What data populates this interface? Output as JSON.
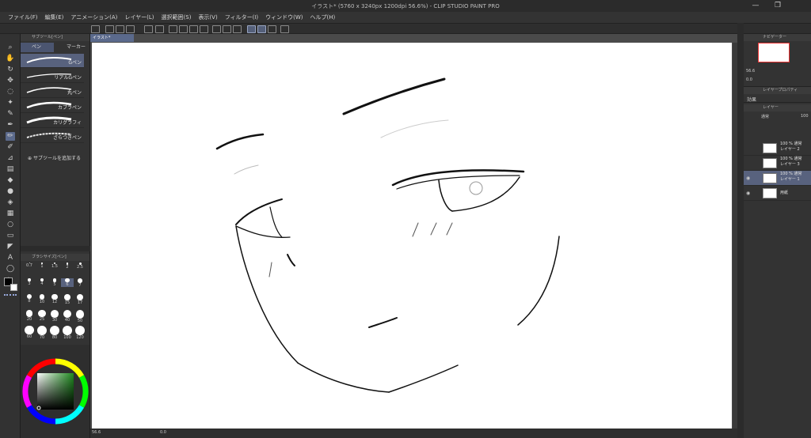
{
  "window": {
    "title": "イラスト* (5760 x 3240px 1200dpi 56.6%) - CLIP STUDIO PAINT PRO",
    "min": "—",
    "restore": "❐"
  },
  "menu": [
    "ファイル(F)",
    "編集(E)",
    "アニメーション(A)",
    "レイヤー(L)",
    "選択範囲(S)",
    "表示(V)",
    "フィルター(I)",
    "ウィンドウ(W)",
    "ヘルプ(H)"
  ],
  "subtool": {
    "header": "サブツール[ペン]",
    "tabs": [
      "ペン",
      "マーカー"
    ],
    "brushes": [
      "Gペン",
      "リアルGペン",
      "丸ペン",
      "カブラペン",
      "カリグラフィ",
      "ざらつきペン"
    ],
    "add": "サブツールを追加する"
  },
  "brush_size": {
    "header": "ブラシサイズ[ペン]",
    "sizes": [
      "0.7",
      "1",
      "1.5",
      "2",
      "2.5",
      "3",
      "4",
      "5",
      "6",
      "7",
      "8",
      "10",
      "12",
      "15",
      "17",
      "20",
      "25",
      "30",
      "40",
      "50",
      "60",
      "70",
      "80",
      "100",
      "120"
    ]
  },
  "color": {
    "main": "#000000",
    "sub": "#ffffff"
  },
  "document": {
    "tab": "イラスト*"
  },
  "status": {
    "zoom": "56.6",
    "angle": "0.0"
  },
  "navigator": {
    "header": "ナビゲーター",
    "zoom": "56.6",
    "angle": "0.0"
  },
  "layer_property": {
    "header": "レイヤープロパティ",
    "effect": "効果"
  },
  "layers": {
    "header": "レイヤー",
    "blend": "通常",
    "opacity": "100",
    "items": [
      {
        "line1": "100 % 通常",
        "line2": "レイヤー 2"
      },
      {
        "line1": "100 % 通常",
        "line2": "レイヤー 3"
      },
      {
        "line1": "100 % 通常",
        "line2": "レイヤー 1"
      },
      {
        "line1": "",
        "line2": "用紙"
      }
    ]
  },
  "colors": {
    "accent": "#5b6a8c",
    "panel": "#333333",
    "canvas_bg": "#4a4a4a"
  }
}
